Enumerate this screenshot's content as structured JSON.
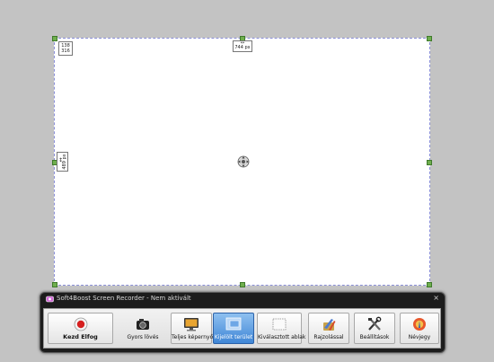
{
  "capture": {
    "width_label": "744 px",
    "height_label": "489 px",
    "offset_x": "138",
    "offset_y": "316"
  },
  "window": {
    "title": "Soft4Boost Screen Recorder - Nem aktivált",
    "close_glyph": "×"
  },
  "toolbar": {
    "buttons": [
      {
        "label": "Kezd Elfog",
        "icon": "record-icon"
      },
      {
        "label": "Gyors lövés",
        "icon": "camera-icon"
      },
      {
        "label": "Teljes képernyő",
        "icon": "monitor-icon"
      },
      {
        "label": "Kijelölt terület",
        "icon": "region-icon",
        "active": true
      },
      {
        "label": "Kiválasztott ablak",
        "icon": "window-select-icon"
      },
      {
        "label": "Rajzolással",
        "icon": "paint-icon"
      },
      {
        "label": "Beállítások",
        "icon": "tools-icon"
      },
      {
        "label": "Névjegy",
        "icon": "about-icon"
      }
    ]
  },
  "colors": {
    "accent": "#3f86d6",
    "handle": "#6fae4e",
    "border_dash": "#8a8fd8"
  }
}
